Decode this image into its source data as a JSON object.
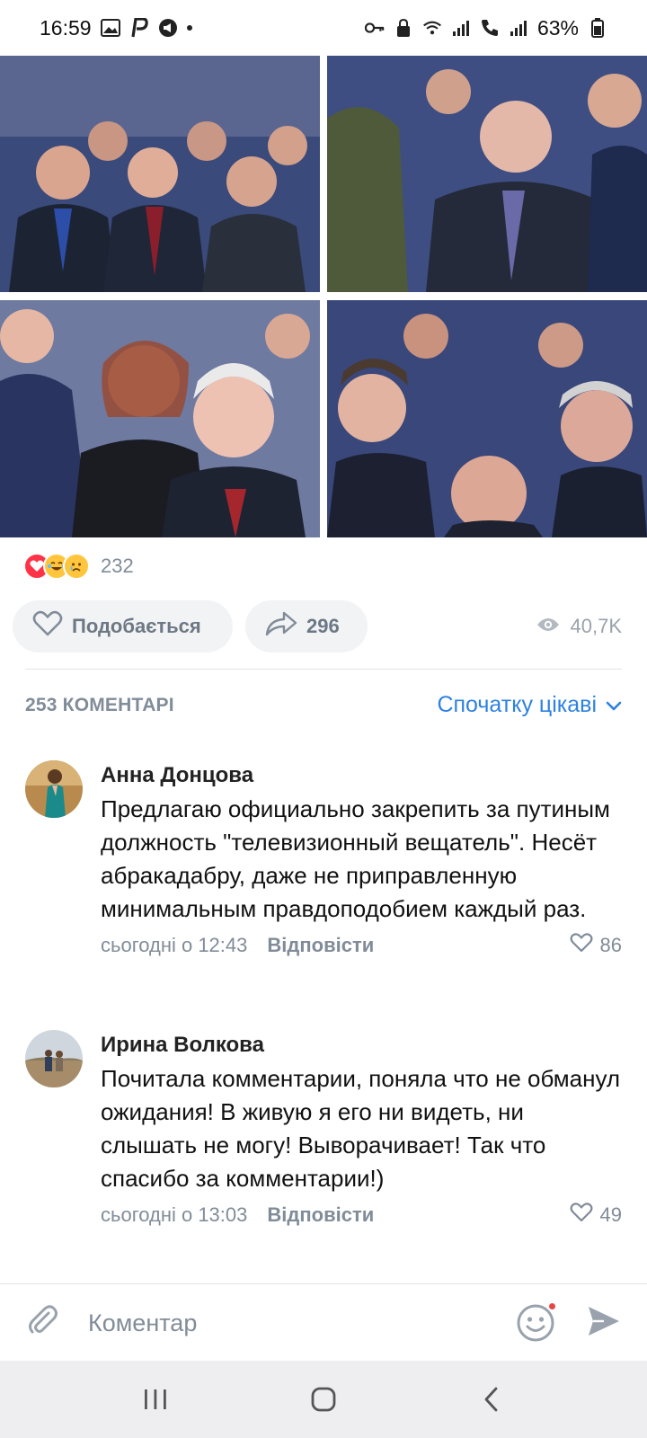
{
  "status_bar": {
    "time": "16:59",
    "battery": "63%",
    "icons": [
      "gallery-icon",
      "p-app-icon",
      "megaphone-icon",
      "key-icon",
      "lock-icon",
      "wifi-icon",
      "signal-icon",
      "call-icon",
      "signal-icon"
    ]
  },
  "post": {
    "photos": [
      {
        "name": "photo-audience-1"
      },
      {
        "name": "photo-audience-2"
      },
      {
        "name": "photo-audience-3"
      },
      {
        "name": "photo-audience-4"
      }
    ],
    "reactions": {
      "icons": [
        "heart-reaction-icon",
        "laughing-reaction-icon",
        "crying-reaction-icon"
      ],
      "count": "232"
    },
    "like_label": "Подобається",
    "share_count": "296",
    "views": "40,7K"
  },
  "comments_section": {
    "count_label": "253 КОМЕНТАРІ",
    "sort_label": "Спочатку цікаві",
    "comments": [
      {
        "author": "Анна Донцова",
        "text": "Предлагаю официально закрепить за путиным должность \"телевизионный вещатель\". Несёт абракадабру, даже не приправленную минимальным правдоподобием каждый раз.",
        "time": "сьогодні о 12:43",
        "reply_label": "Відповісти",
        "likes": "86"
      },
      {
        "author": "Ирина Волкова",
        "text": "Почитала комментарии, поняла что не обманул ожидания! В живую я его ни видеть, ни слышать не могу! Выворачивает! Так что спасибо за комментарии!)",
        "time": "сьогодні о 13:03",
        "reply_label": "Відповісти",
        "likes": "49"
      }
    ]
  },
  "composer": {
    "placeholder": "Коментар"
  },
  "colors": {
    "accent": "#2d81e0",
    "secondary_text": "#818c99",
    "pill_bg": "#f2f3f5",
    "nav_bg": "#eeeef0",
    "notification_dot": "#e64646"
  }
}
